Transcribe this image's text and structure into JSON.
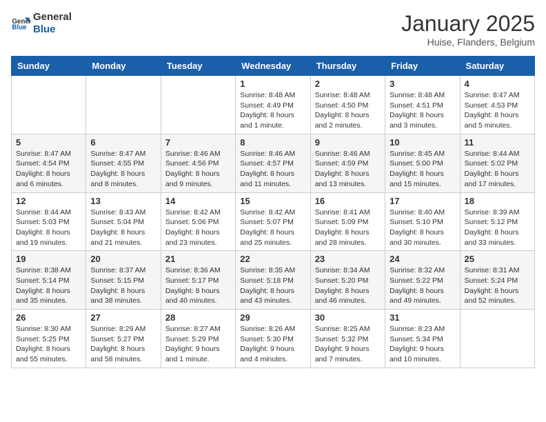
{
  "logo": {
    "general": "General",
    "blue": "Blue"
  },
  "header": {
    "title": "January 2025",
    "subtitle": "Huise, Flanders, Belgium"
  },
  "weekdays": [
    "Sunday",
    "Monday",
    "Tuesday",
    "Wednesday",
    "Thursday",
    "Friday",
    "Saturday"
  ],
  "weeks": [
    [
      {
        "day": "",
        "info": ""
      },
      {
        "day": "",
        "info": ""
      },
      {
        "day": "",
        "info": ""
      },
      {
        "day": "1",
        "info": "Sunrise: 8:48 AM\nSunset: 4:49 PM\nDaylight: 8 hours\nand 1 minute."
      },
      {
        "day": "2",
        "info": "Sunrise: 8:48 AM\nSunset: 4:50 PM\nDaylight: 8 hours\nand 2 minutes."
      },
      {
        "day": "3",
        "info": "Sunrise: 8:48 AM\nSunset: 4:51 PM\nDaylight: 8 hours\nand 3 minutes."
      },
      {
        "day": "4",
        "info": "Sunrise: 8:47 AM\nSunset: 4:53 PM\nDaylight: 8 hours\nand 5 minutes."
      }
    ],
    [
      {
        "day": "5",
        "info": "Sunrise: 8:47 AM\nSunset: 4:54 PM\nDaylight: 8 hours\nand 6 minutes."
      },
      {
        "day": "6",
        "info": "Sunrise: 8:47 AM\nSunset: 4:55 PM\nDaylight: 8 hours\nand 8 minutes."
      },
      {
        "day": "7",
        "info": "Sunrise: 8:46 AM\nSunset: 4:56 PM\nDaylight: 8 hours\nand 9 minutes."
      },
      {
        "day": "8",
        "info": "Sunrise: 8:46 AM\nSunset: 4:57 PM\nDaylight: 8 hours\nand 11 minutes."
      },
      {
        "day": "9",
        "info": "Sunrise: 8:46 AM\nSunset: 4:59 PM\nDaylight: 8 hours\nand 13 minutes."
      },
      {
        "day": "10",
        "info": "Sunrise: 8:45 AM\nSunset: 5:00 PM\nDaylight: 8 hours\nand 15 minutes."
      },
      {
        "day": "11",
        "info": "Sunrise: 8:44 AM\nSunset: 5:02 PM\nDaylight: 8 hours\nand 17 minutes."
      }
    ],
    [
      {
        "day": "12",
        "info": "Sunrise: 8:44 AM\nSunset: 5:03 PM\nDaylight: 8 hours\nand 19 minutes."
      },
      {
        "day": "13",
        "info": "Sunrise: 8:43 AM\nSunset: 5:04 PM\nDaylight: 8 hours\nand 21 minutes."
      },
      {
        "day": "14",
        "info": "Sunrise: 8:42 AM\nSunset: 5:06 PM\nDaylight: 8 hours\nand 23 minutes."
      },
      {
        "day": "15",
        "info": "Sunrise: 8:42 AM\nSunset: 5:07 PM\nDaylight: 8 hours\nand 25 minutes."
      },
      {
        "day": "16",
        "info": "Sunrise: 8:41 AM\nSunset: 5:09 PM\nDaylight: 8 hours\nand 28 minutes."
      },
      {
        "day": "17",
        "info": "Sunrise: 8:40 AM\nSunset: 5:10 PM\nDaylight: 8 hours\nand 30 minutes."
      },
      {
        "day": "18",
        "info": "Sunrise: 8:39 AM\nSunset: 5:12 PM\nDaylight: 8 hours\nand 33 minutes."
      }
    ],
    [
      {
        "day": "19",
        "info": "Sunrise: 8:38 AM\nSunset: 5:14 PM\nDaylight: 8 hours\nand 35 minutes."
      },
      {
        "day": "20",
        "info": "Sunrise: 8:37 AM\nSunset: 5:15 PM\nDaylight: 8 hours\nand 38 minutes."
      },
      {
        "day": "21",
        "info": "Sunrise: 8:36 AM\nSunset: 5:17 PM\nDaylight: 8 hours\nand 40 minutes."
      },
      {
        "day": "22",
        "info": "Sunrise: 8:35 AM\nSunset: 5:18 PM\nDaylight: 8 hours\nand 43 minutes."
      },
      {
        "day": "23",
        "info": "Sunrise: 8:34 AM\nSunset: 5:20 PM\nDaylight: 8 hours\nand 46 minutes."
      },
      {
        "day": "24",
        "info": "Sunrise: 8:32 AM\nSunset: 5:22 PM\nDaylight: 8 hours\nand 49 minutes."
      },
      {
        "day": "25",
        "info": "Sunrise: 8:31 AM\nSunset: 5:24 PM\nDaylight: 8 hours\nand 52 minutes."
      }
    ],
    [
      {
        "day": "26",
        "info": "Sunrise: 8:30 AM\nSunset: 5:25 PM\nDaylight: 8 hours\nand 55 minutes."
      },
      {
        "day": "27",
        "info": "Sunrise: 8:29 AM\nSunset: 5:27 PM\nDaylight: 8 hours\nand 58 minutes."
      },
      {
        "day": "28",
        "info": "Sunrise: 8:27 AM\nSunset: 5:29 PM\nDaylight: 9 hours\nand 1 minute."
      },
      {
        "day": "29",
        "info": "Sunrise: 8:26 AM\nSunset: 5:30 PM\nDaylight: 9 hours\nand 4 minutes."
      },
      {
        "day": "30",
        "info": "Sunrise: 8:25 AM\nSunset: 5:32 PM\nDaylight: 9 hours\nand 7 minutes."
      },
      {
        "day": "31",
        "info": "Sunrise: 8:23 AM\nSunset: 5:34 PM\nDaylight: 9 hours\nand 10 minutes."
      },
      {
        "day": "",
        "info": ""
      }
    ]
  ]
}
